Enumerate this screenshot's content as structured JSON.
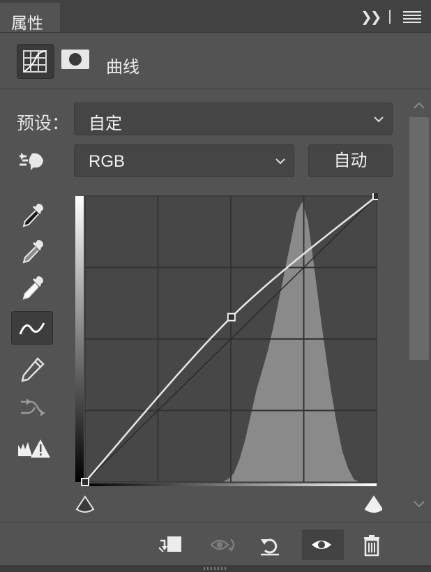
{
  "tab": {
    "title": "属性",
    "collapse_icon": "double-chevron-right-icon",
    "menu_icon": "hamburger-menu-icon"
  },
  "header": {
    "adjustment_icon": "curves-adjustment-icon",
    "mask_icon": "layer-mask-icon",
    "title": "曲线"
  },
  "preset": {
    "label": "预设：",
    "value": "自定"
  },
  "channel": {
    "value": "RGB"
  },
  "auto_button": {
    "label": "自动"
  },
  "tools": [
    "on-image-adjust-icon",
    "black-point-eyedropper-icon",
    "gray-point-eyedropper-icon",
    "white-point-eyedropper-icon",
    "curve-edit-icon",
    "pencil-draw-icon",
    "smooth-curve-icon",
    "clipping-warning-icon"
  ],
  "chart_data": {
    "type": "line",
    "channel": "RGB",
    "xlim": [
      0,
      255
    ],
    "ylim": [
      0,
      255
    ],
    "grid": true,
    "grid_divisions": 4,
    "series": [
      {
        "name": "",
        "role": "curve",
        "points": [
          [
            0,
            0
          ],
          [
            128,
            147
          ],
          [
            255,
            255
          ]
        ]
      },
      {
        "name": "",
        "role": "baseline",
        "points": [
          [
            0,
            0
          ],
          [
            255,
            255
          ]
        ]
      }
    ],
    "histogram": {
      "bins_x": [
        120,
        125,
        130,
        135,
        140,
        145,
        150,
        155,
        160,
        165,
        170,
        175,
        180,
        185,
        190,
        195,
        200,
        205,
        210,
        215,
        220,
        225,
        230,
        235,
        240
      ],
      "relative_heights": [
        0.0,
        0.01,
        0.03,
        0.08,
        0.15,
        0.24,
        0.33,
        0.4,
        0.47,
        0.56,
        0.66,
        0.76,
        0.86,
        0.96,
        1.0,
        0.93,
        0.78,
        0.62,
        0.47,
        0.33,
        0.21,
        0.11,
        0.05,
        0.01,
        0.0
      ]
    },
    "control_points": [
      [
        0,
        0
      ],
      [
        128,
        147
      ],
      [
        255,
        255
      ]
    ]
  },
  "bottom_bar": {
    "clip_icon": "clip-to-layer-icon",
    "view_previous_icon": "view-previous-state-icon",
    "reset_icon": "reset-adjustment-icon",
    "visibility_icon": "toggle-visibility-eye-icon",
    "delete_icon": "delete-trash-icon"
  },
  "colors": {
    "panel_bg": "#535353",
    "graph_bg": "#474747",
    "histogram": "#8a8a8a",
    "curve": "#e8e8e8"
  }
}
